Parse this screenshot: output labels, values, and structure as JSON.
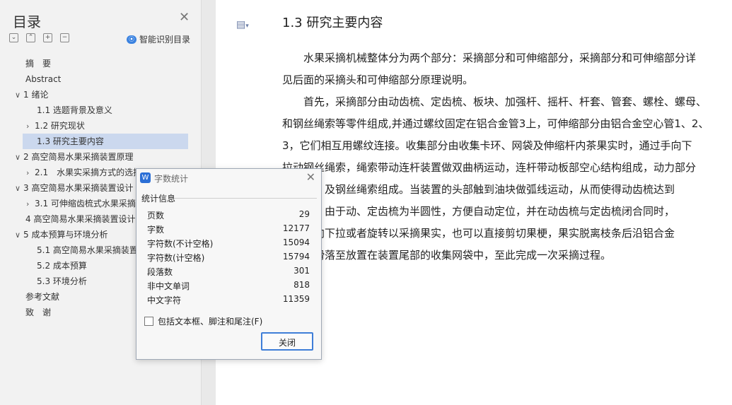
{
  "sidebar": {
    "title": "目录",
    "smart_label": "智能识别目录",
    "items": [
      {
        "label": "摘　要",
        "toggle": ""
      },
      {
        "label": "Abstract",
        "toggle": ""
      },
      {
        "label": "1 绪论",
        "toggle": "∨"
      },
      {
        "label": "1.1 选题背景及意义",
        "toggle": ""
      },
      {
        "label": "1.2 研究现状",
        "toggle": "›"
      },
      {
        "label": "1.3 研究主要内容",
        "toggle": ""
      },
      {
        "label": "2 高空简易水果采摘装置原理",
        "toggle": "∨"
      },
      {
        "label": "2.1　水果实采摘方式的选择",
        "toggle": "›"
      },
      {
        "label": "3 高空简易水果采摘装置设计",
        "toggle": "∨"
      },
      {
        "label": "3.1 可伸缩齿梳式水果采摘",
        "toggle": "›"
      },
      {
        "label": "4 高空简易水果采摘装置设计",
        "toggle": ""
      },
      {
        "label": "5 成本预算与环境分析",
        "toggle": "∨"
      },
      {
        "label": "5.1 高空简易水果采摘装置",
        "toggle": ""
      },
      {
        "label": "5.2 成本预算",
        "toggle": ""
      },
      {
        "label": "5.3 环境分析",
        "toggle": ""
      },
      {
        "label": "参考文献",
        "toggle": ""
      },
      {
        "label": "致　谢",
        "toggle": ""
      }
    ]
  },
  "document": {
    "heading": "1.3 研究主要内容",
    "lines": [
      "　　水果采摘机械整体分为两个部分：采摘部分和可伸缩部分，采摘部分和可伸缩部分详",
      "见后面的采摘头和可伸缩部分原理说明。",
      "　　首先，采摘部分由动齿梳、定齿梳、板块、加强杆、摇杆、杆套、管套、螺栓、螺母、",
      "和钢丝绳索等零件组成,并通过螺纹固定在铝合金管3上，可伸缩部分由铝合金空心管1、2、",
      "3，它们相互用螺纹连接。收集部分由收集卡环、网袋及伸缩杆内茶果实时，通过手向下",
      "拉动钢丝绳索，绳索带动连杆装置做双曲柄运动，连杆带动板部空心结构组成，动力部分",
      "由装置、及钢丝绳索组成。当装置的头部触到油块做弧线运动，从而使得动齿梳达到",
      "的效果，由于动、定齿梳为半圆性，方便自动定位，并在动齿梳与定齿梳闭合同时，",
      "将装置向下拉或者旋转以采摘果实，也可以直接剪切果梗，果实脱离枝条后沿铝合金",
      "管内部滑落至放置在装置尾部的收集网袋中，至此完成一次采摘过程。"
    ]
  },
  "dialog": {
    "title": "字数统计",
    "group_label": "统计信息",
    "stats": [
      {
        "label": "页数",
        "value": "29"
      },
      {
        "label": "字数",
        "value": "12177"
      },
      {
        "label": "字符数(不计空格)",
        "value": "15094"
      },
      {
        "label": "字符数(计空格)",
        "value": "15794"
      },
      {
        "label": "段落数",
        "value": "301"
      },
      {
        "label": "非中文单词",
        "value": "818"
      },
      {
        "label": "中文字符",
        "value": "11359"
      }
    ],
    "checkbox_label": "包括文本框、脚注和尾注(F)",
    "close_label": "关闭"
  }
}
